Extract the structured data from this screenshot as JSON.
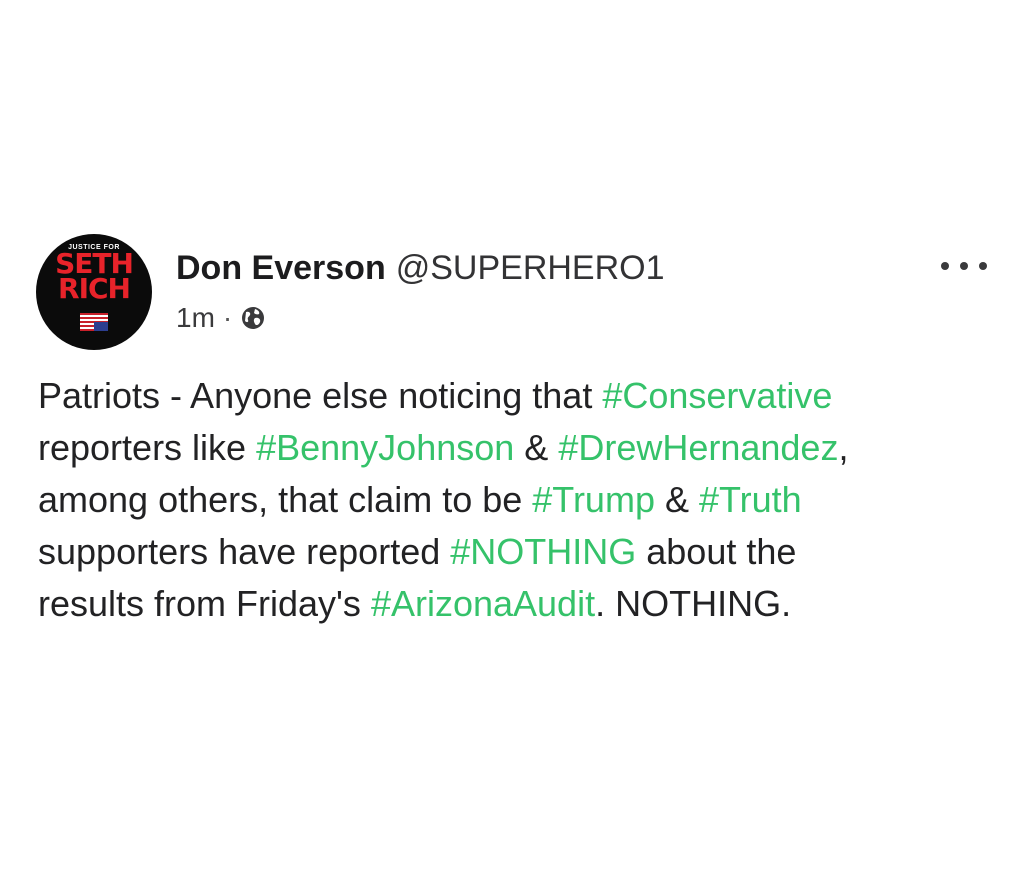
{
  "author": {
    "name": "Don Everson",
    "handle": "@SUPERHERO1",
    "avatar": {
      "top_text": "JUSTICE FOR",
      "line1": "SETH",
      "line2": "RICH",
      "flag_icon": "us-flag-upside-down-icon"
    }
  },
  "meta": {
    "time": "1m",
    "separator": "·",
    "visibility_icon": "globe-icon"
  },
  "menu": {
    "icon": "more-options-icon"
  },
  "post": {
    "lines": [
      [
        {
          "text": "Patriots - Anyone else noticing that ",
          "tag": false
        },
        {
          "text": "#Conservative",
          "tag": true
        }
      ],
      [
        {
          "text": "reporters like ",
          "tag": false
        },
        {
          "text": "#BennyJohnson",
          "tag": true
        },
        {
          "text": " & ",
          "tag": false
        },
        {
          "text": "#DrewHernandez",
          "tag": true
        },
        {
          "text": ",",
          "tag": false
        }
      ],
      [
        {
          "text": "among others, that claim to be ",
          "tag": false
        },
        {
          "text": "#Trump",
          "tag": true
        },
        {
          "text": " & ",
          "tag": false
        },
        {
          "text": "#Truth",
          "tag": true
        }
      ],
      [
        {
          "text": "supporters have reported ",
          "tag": false
        },
        {
          "text": "#NOTHING",
          "tag": true
        },
        {
          "text": " about the",
          "tag": false
        }
      ],
      [
        {
          "text": "results from Friday's ",
          "tag": false
        },
        {
          "text": "#ArizonaAudit",
          "tag": true
        },
        {
          "text": ". NOTHING.",
          "tag": false
        }
      ]
    ]
  },
  "colors": {
    "hashtag": "#35c26a",
    "text": "#222224",
    "avatar_bg": "#0b0b0b",
    "avatar_accent": "#e8232a"
  }
}
